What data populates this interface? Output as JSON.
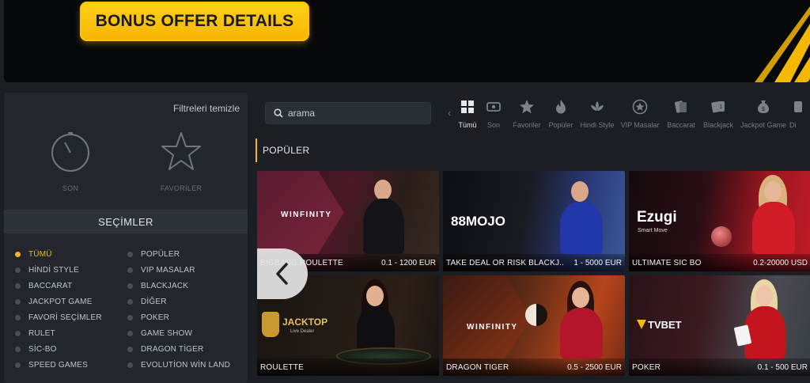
{
  "banner": {
    "bonus_button": "BONUS OFFER DETAILS"
  },
  "filters": {
    "clear_label": "Filtreleri temizle",
    "quick": [
      {
        "label": "SON",
        "icon": "stopwatch-icon"
      },
      {
        "label": "FAVORİLER",
        "icon": "star-icon"
      }
    ],
    "selections_title": "SEÇİMLER",
    "categories": [
      {
        "label": "TÜMÜ",
        "active": true
      },
      {
        "label": "POPÜLER"
      },
      {
        "label": "HİNDİ STYLE"
      },
      {
        "label": "VIP MASALAR"
      },
      {
        "label": "BACCARAT"
      },
      {
        "label": "BLACKJACK"
      },
      {
        "label": "JACKPOT GAME"
      },
      {
        "label": "DİĞER"
      },
      {
        "label": "FAVORİ SEÇİMLER"
      },
      {
        "label": "POKER"
      },
      {
        "label": "RULET"
      },
      {
        "label": "GAME SHOW"
      },
      {
        "label": "SİC-BO"
      },
      {
        "label": "DRAGON TİGER"
      },
      {
        "label": "SPEED GAMES"
      },
      {
        "label": "EVOLUTİON WİN LAND"
      }
    ]
  },
  "search": {
    "placeholder": "arama"
  },
  "tabs": [
    {
      "label": "Tümü",
      "icon": "grid-icon",
      "active": true
    },
    {
      "label": "Son",
      "icon": "ticket-icon"
    },
    {
      "label": "Favoriler",
      "icon": "star-icon"
    },
    {
      "label": "Popüler",
      "icon": "flame-icon"
    },
    {
      "label": "Hindi Style",
      "icon": "lotus-icon"
    },
    {
      "label": "VIP Masalar",
      "icon": "vip-star-icon"
    },
    {
      "label": "Baccarat",
      "icon": "cards-icon"
    },
    {
      "label": "Blackjack",
      "icon": "blackjack-icon"
    },
    {
      "label": "Jackpot Game",
      "icon": "moneybag-icon"
    },
    {
      "label": "Di",
      "icon": "more-icon"
    }
  ],
  "section_title": "POPÜLER",
  "games": [
    {
      "name": "BIGBANG ROULETTE",
      "limits": "0.1 - 1200 EUR",
      "brand": "WINFINITY",
      "theme": "#2a1a22",
      "accent": "#7a2438"
    },
    {
      "name": "TAKE DEAL OR RISK BLACKJ...",
      "limits": "1 - 5000 EUR",
      "brand": "88MOJO",
      "theme": "#14161d",
      "accent": "#2a3a8a"
    },
    {
      "name": "ULTIMATE SİC BO",
      "limits": "0.2-20000 USD",
      "brand": "Ezugi",
      "brand_sub": "Smart Move",
      "theme": "#1a0c10",
      "accent": "#b31b24"
    },
    {
      "name": "ROULETTE",
      "limits": "",
      "brand": "JACKTOP",
      "brand_sub": "Live Dealer",
      "theme": "#1b1512",
      "accent": "#3a2414"
    },
    {
      "name": "DRAGON TİGER",
      "limits": "0.5 - 2500 EUR",
      "brand": "WINFINITY",
      "theme": "#2b1410",
      "accent": "#b5451b"
    },
    {
      "name": "POKER",
      "limits": "0.1 - 500 EUR",
      "brand": "TVBET",
      "theme": "#2a1216",
      "accent": "#8a2030"
    }
  ]
}
